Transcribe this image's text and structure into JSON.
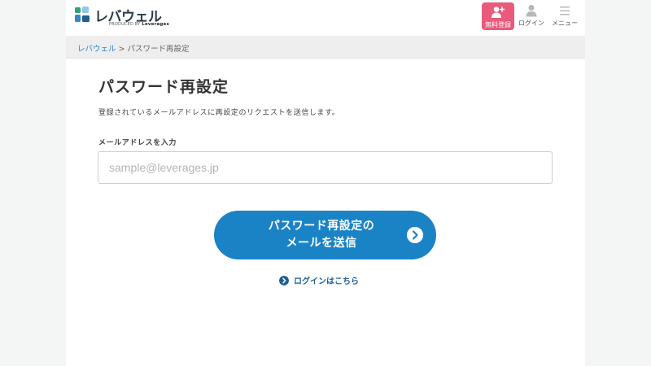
{
  "header": {
    "logo_text": "レバウェル",
    "logo_sub": "PRODUCED BY",
    "logo_sub_brand": "Leverages",
    "signup_label": "無料登録",
    "login_label": "ログイン",
    "menu_label": "メニュー"
  },
  "breadcrumb": {
    "home": "レバウェル",
    "separator": ">",
    "current": "パスワード再設定"
  },
  "main": {
    "title": "パスワード再設定",
    "description": "登録されているメールアドレスに再設定のリクエストを送信します。",
    "email_label": "メールアドレスを入力",
    "email_placeholder": "sample@leverages.jp",
    "email_value": "",
    "submit_line1": "パスワード再設定の",
    "submit_line2": "メールを送信",
    "login_link": "ログインはこちら"
  },
  "colors": {
    "primary": "#1a83c6",
    "signup": "#ea5a7a",
    "link": "#1f5f95"
  }
}
